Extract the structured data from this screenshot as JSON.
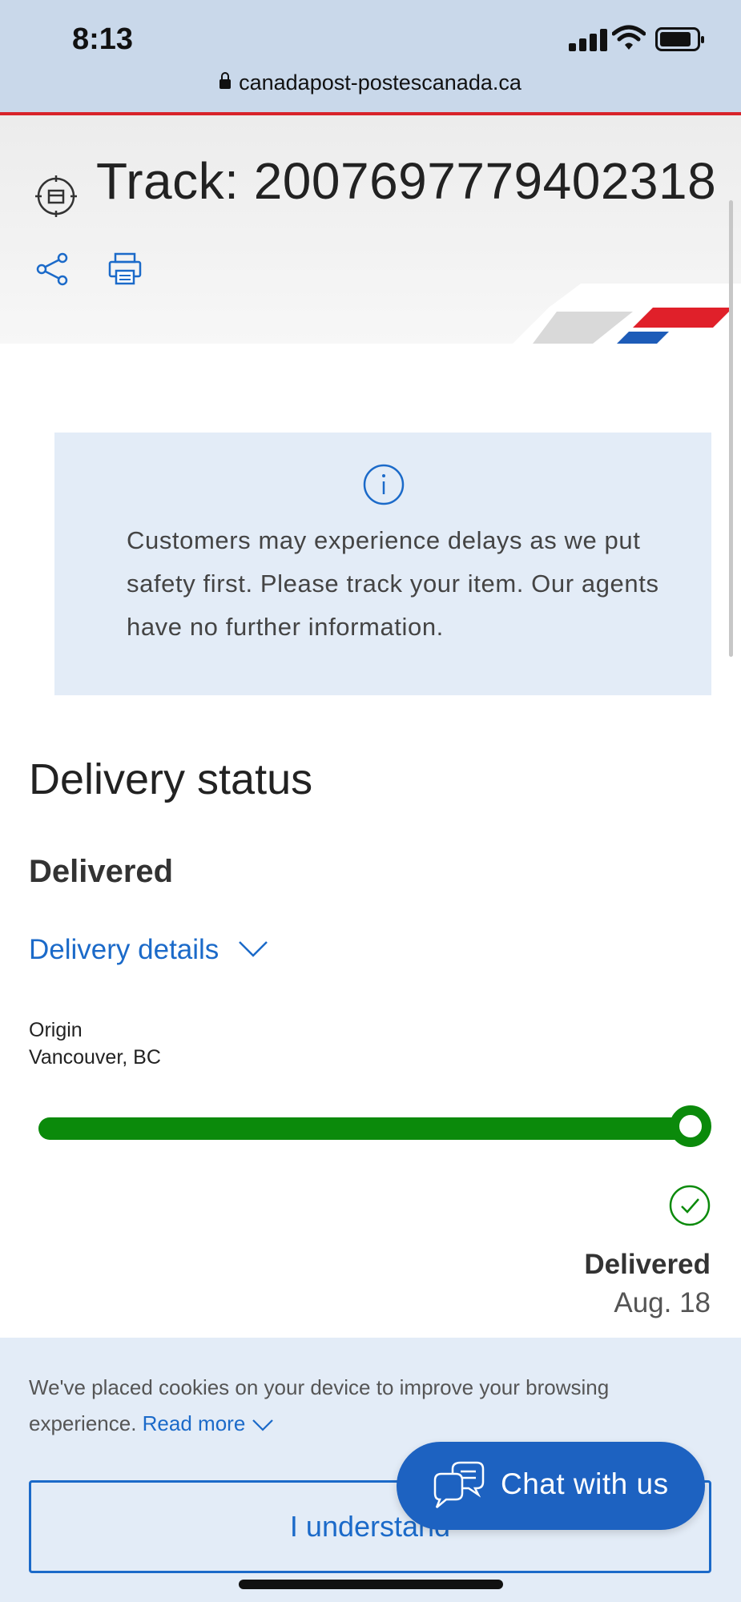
{
  "status_bar": {
    "time": "8:13"
  },
  "browser": {
    "url": "canadapost-postescanada.ca"
  },
  "header": {
    "title": "Track: 2007697779402318"
  },
  "notice": {
    "text": "Customers may experience delays as we put safety first. Please track your item. Our agents have no further information."
  },
  "delivery": {
    "heading": "Delivery status",
    "status": "Delivered",
    "details_link": "Delivery details",
    "origin_label": "Origin",
    "origin_value": "Vancouver, BC",
    "progress_fraction": 1.0,
    "end_status": "Delivered",
    "end_date": "Aug. 18"
  },
  "cookie_banner": {
    "text": "We've placed cookies on your device to improve your browsing experience.",
    "read_more": "Read more",
    "button": "I understand"
  },
  "chat": {
    "label": "Chat with us"
  },
  "colors": {
    "brand_blue": "#1b6ac9",
    "progress_green": "#0b8a0b",
    "brand_red": "#d8232a"
  }
}
